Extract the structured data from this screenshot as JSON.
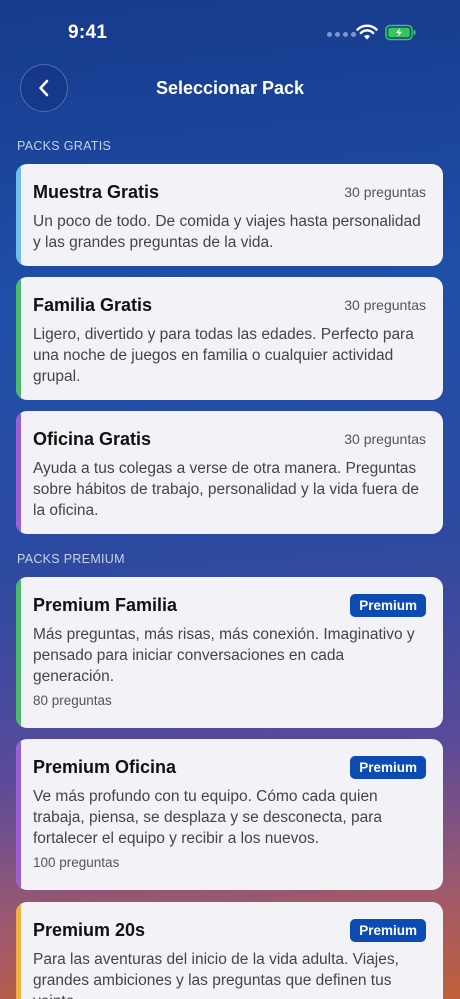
{
  "status": {
    "time": "9:41"
  },
  "nav": {
    "title": "Seleccionar Pack"
  },
  "sections": {
    "free_header": "PACKS GRATIS",
    "premium_header": "PACKS PREMIUM"
  },
  "free_packs": [
    {
      "title": "Muestra Gratis",
      "count": "30 preguntas",
      "description": "Un poco de todo. De comida y viajes hasta personalidad y las grandes preguntas de la vida.",
      "accent": "#6ec0ea"
    },
    {
      "title": "Familia Gratis",
      "count": "30 preguntas",
      "description": "Ligero, divertido y para todas las edades. Perfecto para una noche de juegos en familia o cualquier actividad grupal.",
      "accent": "#4cb870"
    },
    {
      "title": "Oficina Gratis",
      "count": "30 preguntas",
      "description": "Ayuda a tus colegas a verse de otra manera. Preguntas sobre hábitos de trabajo, personalidad y la vida fuera de la oficina.",
      "accent": "#9a5fd0"
    }
  ],
  "premium_packs": [
    {
      "title": "Premium Familia",
      "badge": "Premium",
      "description": "Más preguntas, más risas, más conexión. Imaginativo y pensado para iniciar conversaciones en cada generación.",
      "count": "80 preguntas",
      "accent": "#4cb870"
    },
    {
      "title": "Premium Oficina",
      "badge": "Premium",
      "description": "Ve más profundo con tu equipo. Cómo cada quien trabaja, piensa, se desplaza y se desconecta, para fortalecer el equipo y recibir a los nuevos.",
      "count": "100 preguntas",
      "accent": "#9a5fd0"
    },
    {
      "title": "Premium 20s",
      "badge": "Premium",
      "description": "Para las aventuras del inicio de la vida adulta. Viajes, grandes ambiciones y las preguntas que definen tus veinte.",
      "count": "",
      "accent": "#f0b040"
    }
  ]
}
